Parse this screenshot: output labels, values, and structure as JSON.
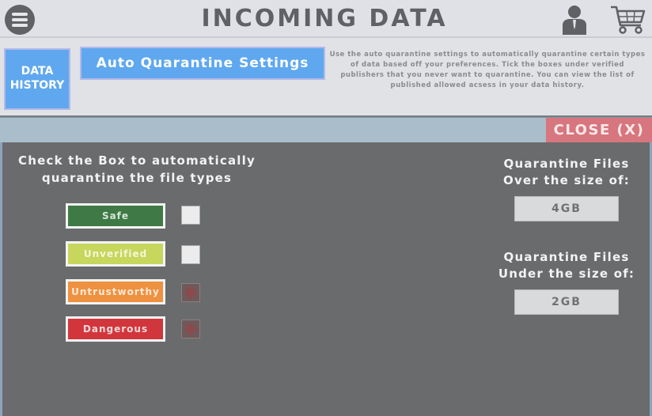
{
  "header": {
    "title": "INCOMING DATA",
    "menu_icon": "hamburger-icon",
    "user_icon": "user-icon",
    "cart_icon": "cart-icon"
  },
  "subheader": {
    "data_history_label": "DATA HISTORY",
    "auto_quarantine_label": "Auto Quarantine Settings",
    "description": "Use the auto quarantine settings to automatically quarantine certain types of data based off your preferences. Tick the boxes under verified publishers that you never want to quarantine. You can view the list of published allowed acsess in your data history."
  },
  "dialog": {
    "close_label": "CLOSE (X)",
    "instructions": "Check the Box to automatically quarantine the file types",
    "file_types": [
      {
        "label": "Safe",
        "checked": false,
        "color": "#3f7a46"
      },
      {
        "label": "Unverified",
        "checked": false,
        "color": "#c7d65d"
      },
      {
        "label": "Untrustworthy",
        "checked": true,
        "color": "#ee9140"
      },
      {
        "label": "Dangerous",
        "checked": true,
        "color": "#d1363c"
      }
    ],
    "over_label": "Quarantine Files Over the size of:",
    "over_value": "4GB",
    "under_label": "Quarantine Files Under the size of:",
    "under_value": "2GB"
  },
  "colors": {
    "accent_blue": "#5fa8ef",
    "close_red": "#d7767e",
    "panel_gray": "#6a6b6d"
  }
}
